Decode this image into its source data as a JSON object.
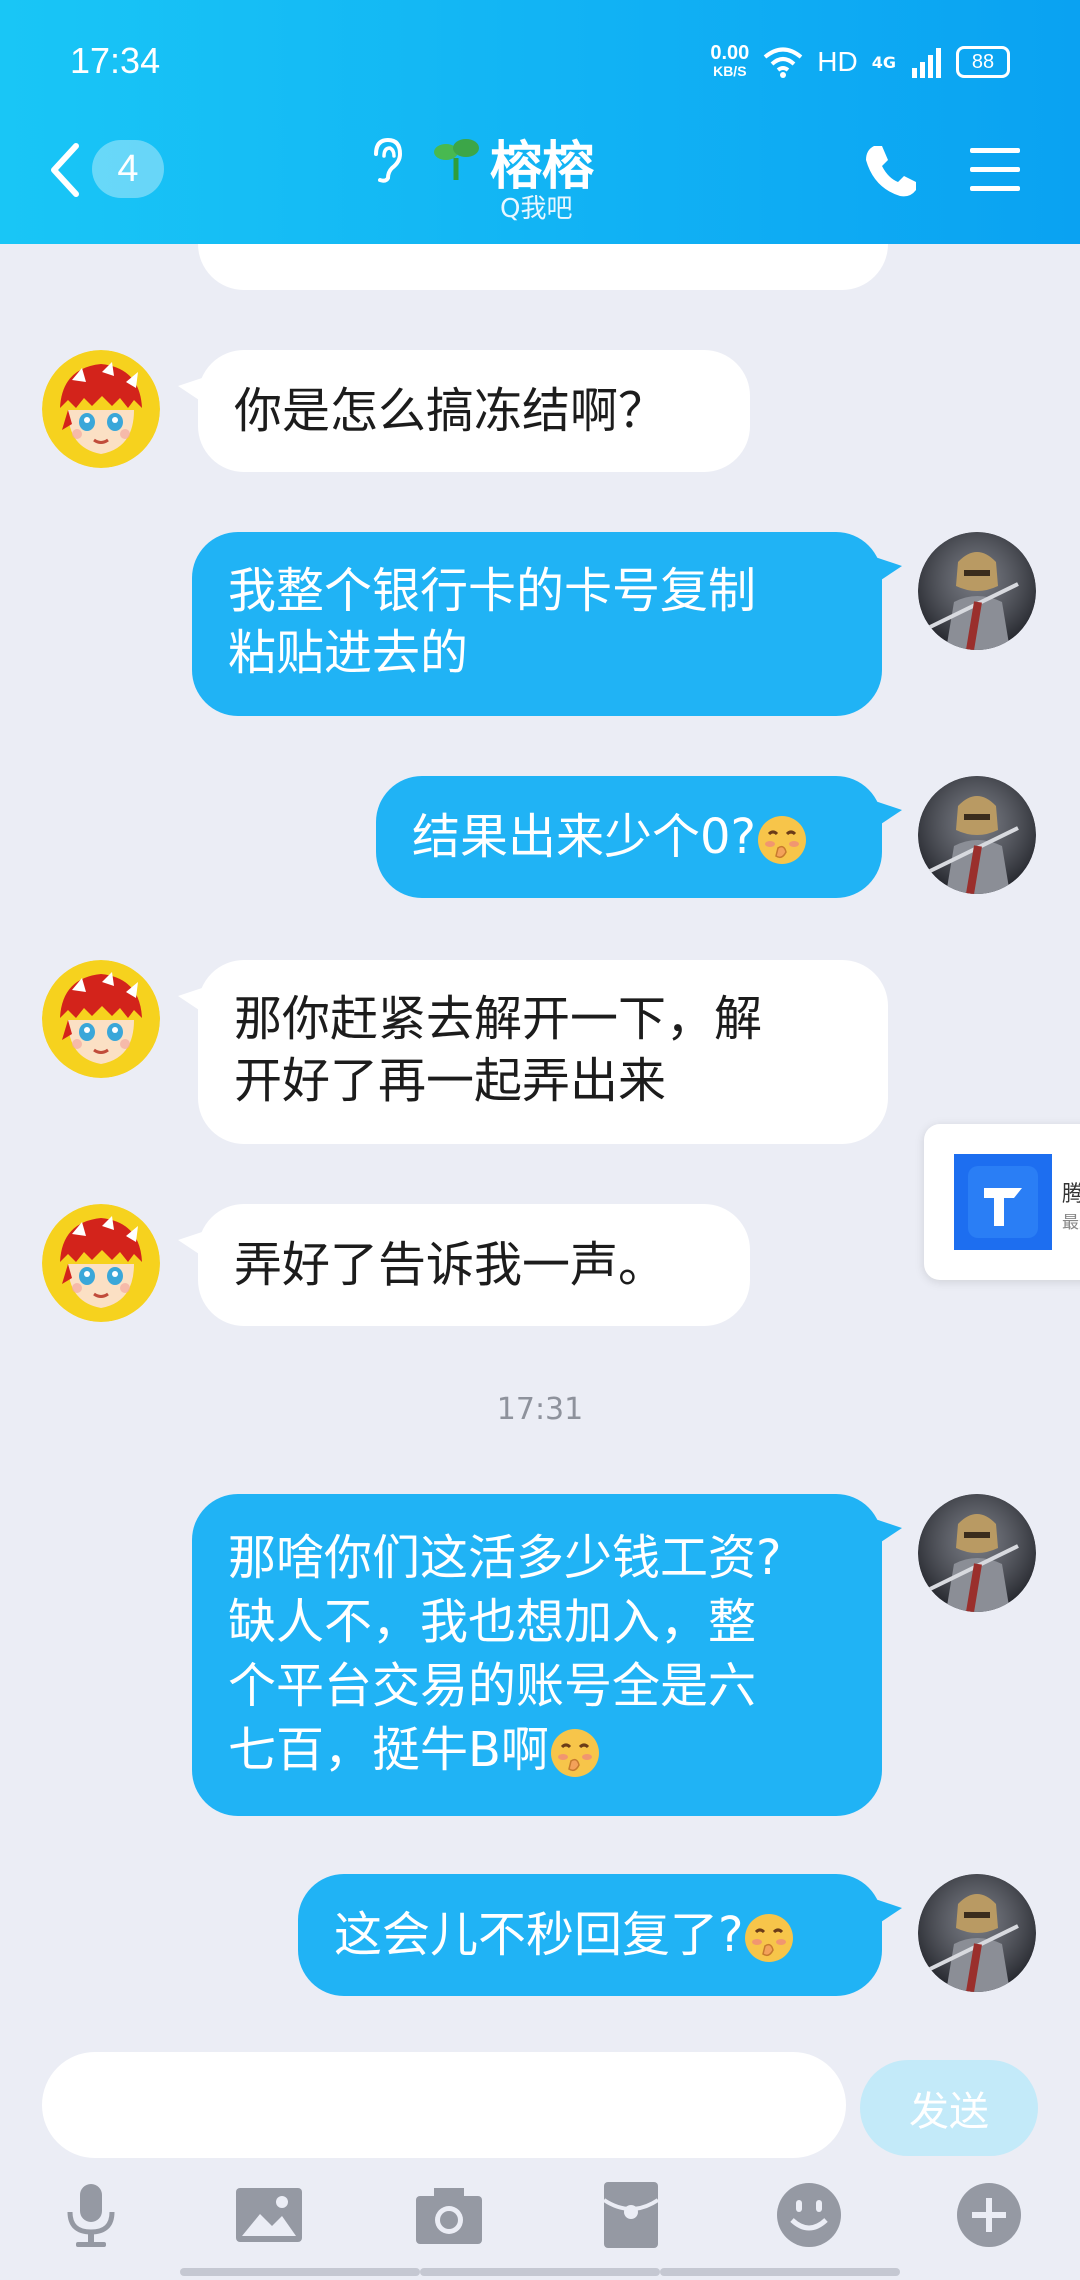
{
  "status_bar": {
    "time": "17:34",
    "net_speed": "0.00",
    "net_speed_unit": "KB/S",
    "hd": "HD",
    "network": "4G",
    "battery": "88"
  },
  "header": {
    "unread_count": "4",
    "contact_name": "榕榕",
    "contact_status": "Q我吧"
  },
  "messages": [
    {
      "side": "in",
      "text": "你是怎么搞冻结啊？"
    },
    {
      "side": "out",
      "lines": [
        "我整个银行卡的卡号复制",
        "粘贴进去的"
      ]
    },
    {
      "side": "out",
      "text": "结果出来少个0?",
      "emoji": "shush-face"
    },
    {
      "side": "in",
      "lines": [
        "那你赶紧去解开一下，解",
        "开好了再一起弄出来"
      ]
    },
    {
      "side": "in",
      "text": "弄好了告诉我一声。"
    },
    {
      "side": "out",
      "lines": [
        "那啥你们这活多少钱工资?",
        "缺人不，我也想加入，整",
        "个平台交易的账号全是六",
        "七百，挺牛B啊"
      ],
      "emoji": "shush-face"
    },
    {
      "side": "out",
      "text": "这会儿不秒回复了?",
      "emoji": "shush-face"
    }
  ],
  "time_separator": "17:31",
  "floating_card": {
    "title": "腾讯",
    "subtitle": "最近"
  },
  "input": {
    "value": "",
    "send_label": "发送"
  },
  "toolbar": [
    "microphone-icon",
    "image-icon",
    "camera-icon",
    "red-packet-icon",
    "emoji-icon",
    "plus-icon"
  ],
  "colors": {
    "header": "#12b4f4",
    "bubble_out": "#20b3f5",
    "bubble_in": "#ffffff",
    "background": "#ebedf5",
    "send_button": "#c3eaf9"
  }
}
